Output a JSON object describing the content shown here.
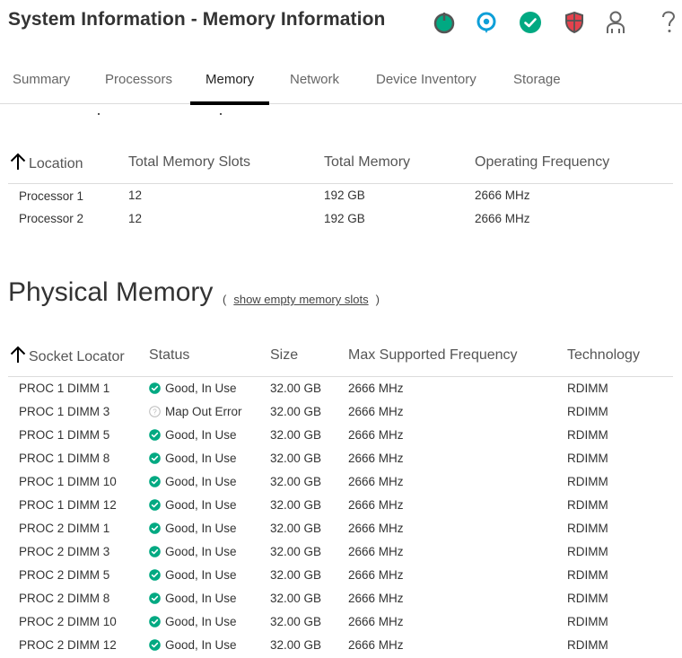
{
  "header": {
    "title": "System Information - Memory Information",
    "icons": [
      {
        "name": "power-icon",
        "color": "#01a982"
      },
      {
        "name": "location-icon",
        "color": "#0d9fd8"
      },
      {
        "name": "health-ok-icon",
        "color": "#01a982"
      },
      {
        "name": "security-shield-icon",
        "color": "#e5424d"
      },
      {
        "name": "user-icon",
        "color": "#666666"
      },
      {
        "name": "help-icon",
        "color": "#666666"
      }
    ]
  },
  "tabs": [
    {
      "label": "Summary",
      "active": false
    },
    {
      "label": "Processors",
      "active": false
    },
    {
      "label": "Memory",
      "active": true
    },
    {
      "label": "Network",
      "active": false
    },
    {
      "label": "Device Inventory",
      "active": false
    },
    {
      "label": "Storage",
      "active": false
    }
  ],
  "summary_table": {
    "columns": [
      "Location",
      "Total Memory Slots",
      "Total Memory",
      "Operating Frequency"
    ],
    "sort_column": "Location",
    "rows": [
      [
        "Processor 1",
        "12",
        "192 GB",
        "2666 MHz"
      ],
      [
        "Processor 2",
        "12",
        "192 GB",
        "2666 MHz"
      ]
    ]
  },
  "physical_memory": {
    "title": "Physical Memory",
    "empty_slots_open": "(",
    "empty_slots_link": "show empty memory slots",
    "empty_slots_close": ")",
    "columns": [
      "Socket Locator",
      "Status",
      "Size",
      "Max Supported Frequency",
      "Technology"
    ],
    "sort_column": "Socket Locator",
    "status_colors": {
      "ok": "#01a982",
      "unknown": "#bbbbbb"
    },
    "rows": [
      {
        "socket": "PROC 1 DIMM 1",
        "status": "Good, In Use",
        "status_type": "ok",
        "size": "32.00 GB",
        "freq": "2666 MHz",
        "tech": "RDIMM"
      },
      {
        "socket": "PROC 1 DIMM 3",
        "status": "Map Out Error",
        "status_type": "unknown",
        "size": "32.00 GB",
        "freq": "2666 MHz",
        "tech": "RDIMM"
      },
      {
        "socket": "PROC 1 DIMM 5",
        "status": "Good, In Use",
        "status_type": "ok",
        "size": "32.00 GB",
        "freq": "2666 MHz",
        "tech": "RDIMM"
      },
      {
        "socket": "PROC 1 DIMM 8",
        "status": "Good, In Use",
        "status_type": "ok",
        "size": "32.00 GB",
        "freq": "2666 MHz",
        "tech": "RDIMM"
      },
      {
        "socket": "PROC 1 DIMM 10",
        "status": "Good, In Use",
        "status_type": "ok",
        "size": "32.00 GB",
        "freq": "2666 MHz",
        "tech": "RDIMM"
      },
      {
        "socket": "PROC 1 DIMM 12",
        "status": "Good, In Use",
        "status_type": "ok",
        "size": "32.00 GB",
        "freq": "2666 MHz",
        "tech": "RDIMM"
      },
      {
        "socket": "PROC 2 DIMM 1",
        "status": "Good, In Use",
        "status_type": "ok",
        "size": "32.00 GB",
        "freq": "2666 MHz",
        "tech": "RDIMM"
      },
      {
        "socket": "PROC 2 DIMM 3",
        "status": "Good, In Use",
        "status_type": "ok",
        "size": "32.00 GB",
        "freq": "2666 MHz",
        "tech": "RDIMM"
      },
      {
        "socket": "PROC 2 DIMM 5",
        "status": "Good, In Use",
        "status_type": "ok",
        "size": "32.00 GB",
        "freq": "2666 MHz",
        "tech": "RDIMM"
      },
      {
        "socket": "PROC 2 DIMM 8",
        "status": "Good, In Use",
        "status_type": "ok",
        "size": "32.00 GB",
        "freq": "2666 MHz",
        "tech": "RDIMM"
      },
      {
        "socket": "PROC 2 DIMM 10",
        "status": "Good, In Use",
        "status_type": "ok",
        "size": "32.00 GB",
        "freq": "2666 MHz",
        "tech": "RDIMM"
      },
      {
        "socket": "PROC 2 DIMM 12",
        "status": "Good, In Use",
        "status_type": "ok",
        "size": "32.00 GB",
        "freq": "2666 MHz",
        "tech": "RDIMM"
      }
    ]
  }
}
